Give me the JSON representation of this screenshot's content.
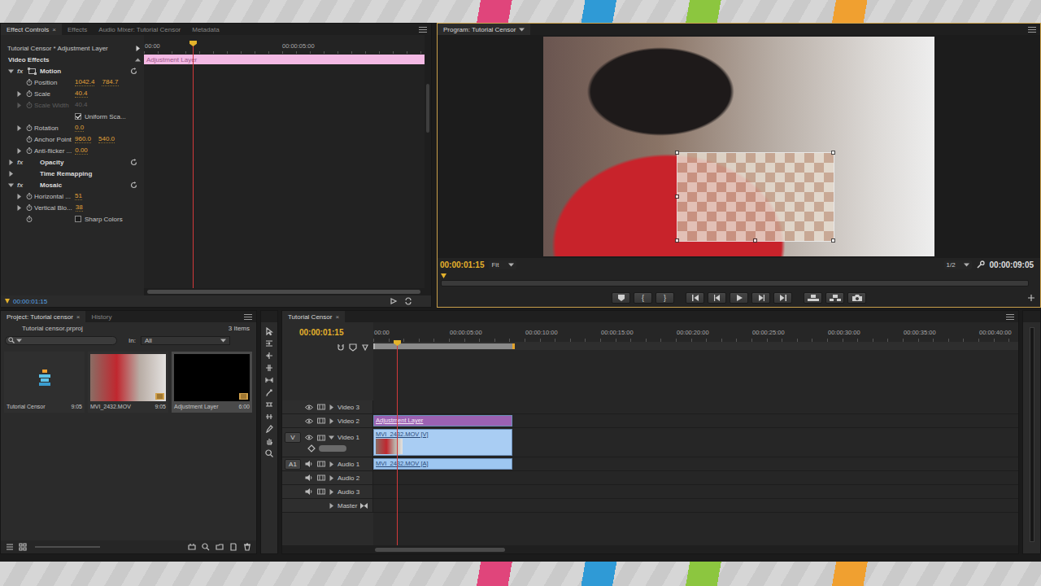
{
  "effect_controls": {
    "focused": false,
    "tabs": [
      {
        "label": "Effect Controls",
        "selected": true,
        "close": "×"
      },
      {
        "label": "Effects",
        "selected": false,
        "close": ""
      },
      {
        "label": "Audio Mixer: Tutorial Censor",
        "selected": false,
        "close": ""
      },
      {
        "label": "Metadata",
        "selected": false,
        "close": ""
      }
    ],
    "clip_title": "Tutorial Censor * Adjustment Layer",
    "ruler": [
      "00:00",
      "00:00:05:00"
    ],
    "clip_bar": "Adjustment Layer",
    "section": "Video Effects",
    "fx_label": "fx",
    "rows": [
      {
        "kind": "effect",
        "label": "Motion",
        "expanded": true,
        "fx": true,
        "reset": true,
        "transform_icon": true
      },
      {
        "kind": "param",
        "label": "Position",
        "values": [
          "1042.4",
          "784.7"
        ],
        "expandable": false,
        "stopwatch": true,
        "disabled": false
      },
      {
        "kind": "param",
        "label": "Scale",
        "values": [
          "40.4"
        ],
        "expandable": true,
        "stopwatch": true,
        "disabled": false
      },
      {
        "kind": "param",
        "label": "Scale Width",
        "values": [
          "40.4"
        ],
        "expandable": true,
        "stopwatch": true,
        "disabled": true
      },
      {
        "kind": "checkbox",
        "label": "Uniform Sca...",
        "checked": true,
        "stopwatch": false
      },
      {
        "kind": "param",
        "label": "Rotation",
        "values": [
          "0.0"
        ],
        "expandable": true,
        "stopwatch": true,
        "disabled": false
      },
      {
        "kind": "param",
        "label": "Anchor Point",
        "values": [
          "960.0",
          "540.0"
        ],
        "expandable": false,
        "stopwatch": true,
        "disabled": false
      },
      {
        "kind": "param",
        "label": "Anti-flicker ...",
        "values": [
          "0.00"
        ],
        "expandable": true,
        "stopwatch": true,
        "disabled": false
      },
      {
        "kind": "effect",
        "label": "Opacity",
        "expanded": false,
        "fx": true,
        "reset": true,
        "transform_icon": false
      },
      {
        "kind": "effect",
        "label": "Time Remapping",
        "expanded": false,
        "fx": false,
        "reset": false,
        "transform_icon": false
      },
      {
        "kind": "effect",
        "label": "Mosaic",
        "expanded": true,
        "fx": true,
        "reset": true,
        "transform_icon": false
      },
      {
        "kind": "param",
        "label": "Horizontal ...",
        "values": [
          "51"
        ],
        "expandable": true,
        "stopwatch": true,
        "disabled": false
      },
      {
        "kind": "param",
        "label": "Vertical Blo...",
        "values": [
          "38"
        ],
        "expandable": true,
        "stopwatch": true,
        "disabled": false
      },
      {
        "kind": "checkbox",
        "label": "Sharp Colors",
        "checked": false,
        "stopwatch": true
      }
    ],
    "timecode": "00:00:01:15"
  },
  "program": {
    "focused": true,
    "tab": {
      "label": "Program: Tutorial Censor",
      "selected": true
    },
    "timecode": "00:00:01:15",
    "zoom": "Fit",
    "resolution": "1/2",
    "duration": "00:00:09:05",
    "mark_in": "{",
    "mark_out": "}"
  },
  "project": {
    "tabs": [
      {
        "label": "Project: Tutorial censor",
        "selected": true,
        "close": "×"
      },
      {
        "label": "History",
        "selected": false,
        "close": ""
      }
    ],
    "file": "Tutorial censor.prproj",
    "count": "3 Items",
    "in_label": "In:",
    "in_value": "All",
    "items": [
      {
        "name": "Tutorial Censor",
        "duration": "9:05",
        "kind": "sequence",
        "selected": false
      },
      {
        "name": "MVI_2432.MOV",
        "duration": "9:05",
        "kind": "video",
        "selected": false
      },
      {
        "name": "Adjustment Layer",
        "duration": "6:00",
        "kind": "adjustment",
        "selected": true
      }
    ]
  },
  "timeline": {
    "tab": {
      "label": "Tutorial Censor",
      "selected": true,
      "close": "×"
    },
    "timecode": "00:00:01:15",
    "ruler": [
      "00:00",
      "00:00:05:00",
      "00:00:10:00",
      "00:00:15:00",
      "00:00:20:00",
      "00:00:25:00",
      "00:00:30:00",
      "00:00:35:00",
      "00:00:40:00"
    ],
    "tracks": [
      {
        "name": "Video 3",
        "kind": "video",
        "expanded": false,
        "source": "",
        "clips": []
      },
      {
        "name": "Video 2",
        "kind": "video",
        "expanded": false,
        "source": "",
        "clips": [
          {
            "label": "Adjustment Layer",
            "color": "#9b61b2"
          }
        ]
      },
      {
        "name": "Video 1",
        "kind": "video",
        "expanded": true,
        "source": "V",
        "clips": [
          {
            "label": "MVI_2432.MOV [V]",
            "color": "#a9cdf3"
          }
        ]
      },
      {
        "name": "Audio 1",
        "kind": "audio",
        "expanded": false,
        "source": "A1",
        "clips": [
          {
            "label": "MVI_2432.MOV [A]",
            "color": "#9ec7f1"
          }
        ]
      },
      {
        "name": "Audio 2",
        "kind": "audio",
        "expanded": false,
        "source": "",
        "clips": []
      },
      {
        "name": "Audio 3",
        "kind": "audio",
        "expanded": false,
        "source": "",
        "clips": []
      },
      {
        "name": "Master",
        "kind": "master",
        "expanded": false,
        "source": "",
        "clips": []
      }
    ]
  }
}
